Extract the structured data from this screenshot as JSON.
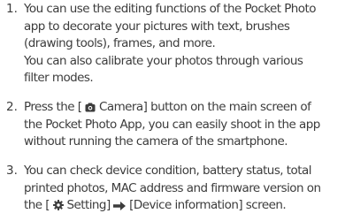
{
  "steps": [
    {
      "number": "1.",
      "lines": [
        "You can use the editing functions of the Pocket Photo",
        "app to decorate your pictures with text, brushes",
        "(drawing tools), frames, and more.",
        "You can also calibrate your photos through various",
        "filter modes."
      ]
    },
    {
      "number": "2.",
      "line1_before": "Press the [ ",
      "camera_icon": "camera-icon",
      "line1_after": " Camera] button on the main screen of",
      "lines_rest": [
        "the Pocket Photo App, you can easily shoot in the app",
        "without running the camera of the smartphone."
      ]
    },
    {
      "number": "3.",
      "lines": [
        "You can check device condition, battery status, total",
        "printed photos, MAC address and firmware version on"
      ],
      "last_before": "the [ ",
      "gear_icon": "gear-icon",
      "setting_text": " Setting] ",
      "arrow_icon": "right-arrow-icon",
      "last_after": " [Device information] screen."
    }
  ]
}
